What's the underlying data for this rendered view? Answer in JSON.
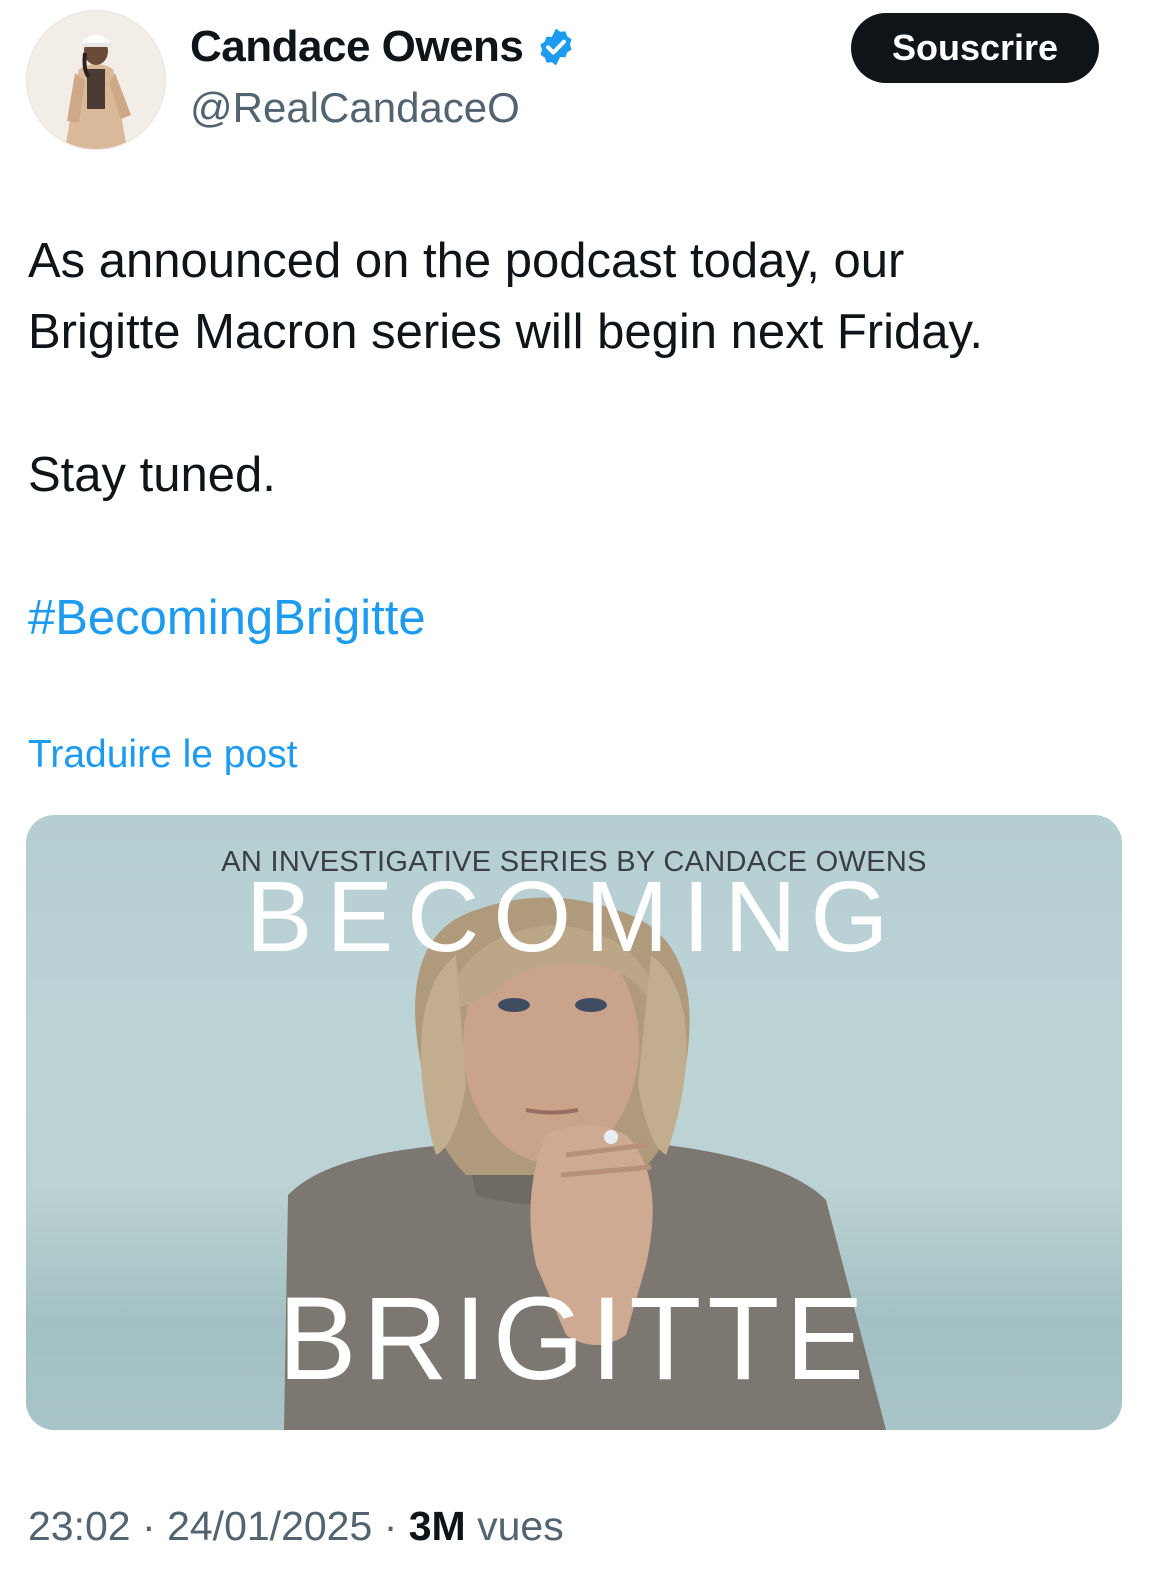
{
  "author": {
    "display_name": "Candace Owens",
    "handle": "@RealCandaceO",
    "verified": true,
    "avatar_icon": "profile-photo"
  },
  "subscribe_label": "Souscrire",
  "tweet": {
    "line1": "As announced on the podcast today, our",
    "line2": "Brigitte Macron series will begin next Friday.",
    "line3": "Stay tuned.",
    "hashtag": "#BecomingBrigitte"
  },
  "translate_label": "Traduire le post",
  "media": {
    "kicker": "AN INVESTIGATIVE SERIES BY CANDACE OWENS",
    "title_top": "BECOMING",
    "title_bottom": "BRIGITTE"
  },
  "meta": {
    "time": "23:02",
    "sep1": "·",
    "date": "24/01/2025",
    "sep2": "·",
    "views_count": "3M",
    "views_label": "vues"
  },
  "colors": {
    "link": "#1d9bf0",
    "text": "#0f1419",
    "muted": "#536471",
    "button_bg": "#0f1419"
  }
}
